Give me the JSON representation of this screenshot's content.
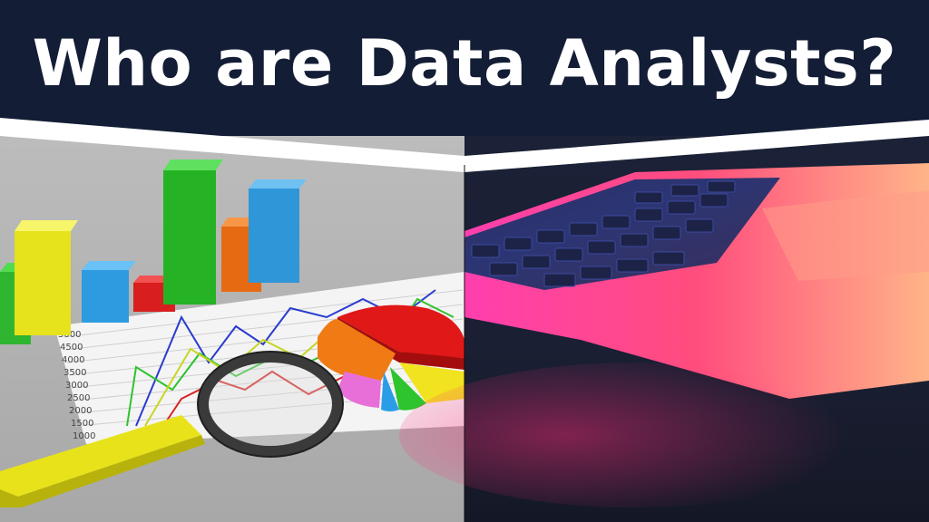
{
  "title": "Who are Data Analysts?",
  "chart_axis_ticks": [
    "5000",
    "4500",
    "4000",
    "3500",
    "3000",
    "2500",
    "2000",
    "1500",
    "1000"
  ],
  "colors": {
    "banner": "#131d35",
    "title": "#ffffff",
    "divider": "#ffffff"
  }
}
